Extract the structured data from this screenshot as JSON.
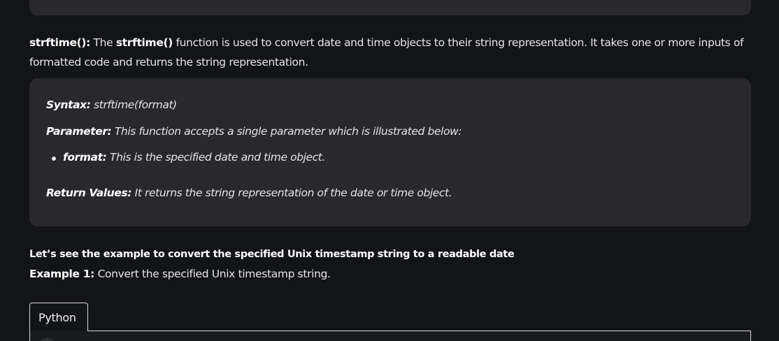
{
  "intro": {
    "term": "strftime():",
    "text1": " The ",
    "func": "strftime()",
    "text2": " function is used to convert date and time objects to their string representation. It takes one or more inputs of formatted code and returns the string representation."
  },
  "syntax_box": {
    "syntax_label": "Syntax:",
    "syntax_value": " strftime(format)",
    "param_label": "Parameter:",
    "param_value": " This function accepts a single parameter which is illustrated below:",
    "format_label": "format:",
    "format_value": " This is the specified date and time object.",
    "return_label": "Return Values:",
    "return_value": " It returns the string representation of the date or time object."
  },
  "example": {
    "lead": "Let’s see the example to convert the specified Unix timestamp string to a readable date",
    "label": "Example 1:",
    "text": " Convert the specified Unix timestamp string."
  },
  "code_tabs": {
    "active_tab": "Python"
  }
}
